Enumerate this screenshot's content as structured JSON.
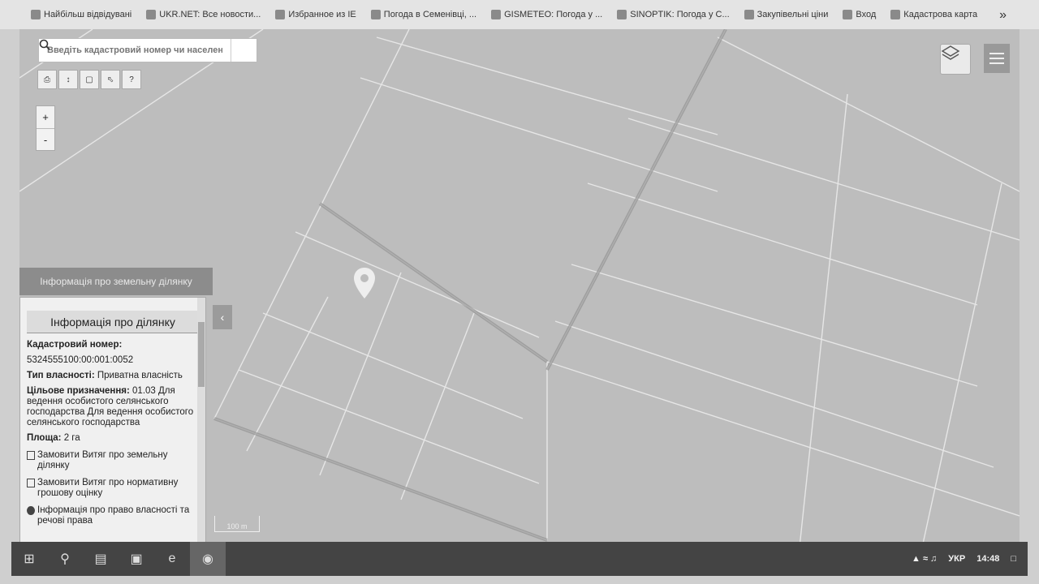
{
  "bookmarks": [
    {
      "label": "Найбільш відвідувані",
      "icon": "gear-icon"
    },
    {
      "label": "UKR.NET: Все новости...",
      "icon": "globe-icon"
    },
    {
      "label": "Избранное из IE",
      "icon": "folder-icon"
    },
    {
      "label": "Погода в Семенівці, ...",
      "icon": "cloud-icon"
    },
    {
      "label": "GISMETEO: Погода у ...",
      "icon": "drop-icon"
    },
    {
      "label": "SINOPTIK: Погода у С...",
      "icon": "thermometer-icon"
    },
    {
      "label": "Закупівельні ціни",
      "icon": "box-icon"
    },
    {
      "label": "Вход",
      "icon": "checkbox-icon"
    },
    {
      "label": "Кадастрова карта",
      "icon": "map-icon"
    }
  ],
  "bookmarks_more": "»",
  "search": {
    "placeholder": "Введіть кадастровий номер чи населений"
  },
  "toolbar": [
    "print-icon",
    "measure-icon",
    "select-area-icon",
    "pointer-icon",
    "help-icon"
  ],
  "zoom": {
    "in": "+",
    "out": "-"
  },
  "panel": {
    "header": "Інформація про земельну ділянку",
    "title": "Інформація про ділянку",
    "cad_label": "Кадастровий номер:",
    "cad_value": "5324555100:00:001:0052",
    "ownership_label": "Тип власності:",
    "ownership_value": "Приватна власність",
    "purpose_label": "Цільове призначення:",
    "purpose_value": "01.03 Для ведення особистого селянського господарства Для ведення особистого селянського господарства",
    "area_label": "Площа:",
    "area_value": "2 га",
    "link1": "Замовити Витяг про земельну ділянку",
    "link2": "Замовити Витяг про нормативну грошову оцінку",
    "link3": "Інформація про право власності та речові права"
  },
  "collapse": "‹",
  "scale": "100 m",
  "info": "i",
  "tray": {
    "lang": "УКР",
    "time": "14:48"
  }
}
